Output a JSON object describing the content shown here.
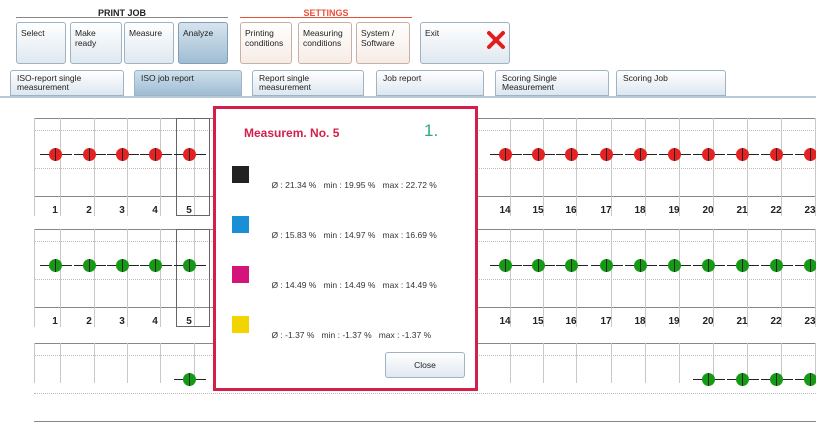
{
  "toolbar": {
    "groups": [
      {
        "title": "PRINT JOB",
        "color": "#222222",
        "line_color": "#888888"
      },
      {
        "title": "SETTINGS",
        "color": "#e8503a",
        "line_color": "#e8503a"
      }
    ],
    "buttons": [
      {
        "label": "Select",
        "active": false
      },
      {
        "label": "Make ready",
        "active": false
      },
      {
        "label": "Measure",
        "active": false
      },
      {
        "label": "Analyze",
        "active": true
      },
      {
        "label": "Printing conditions",
        "active": false
      },
      {
        "label": "Measuring conditions",
        "active": false
      },
      {
        "label": "System / Software",
        "active": false
      },
      {
        "label": "Exit",
        "active": false
      }
    ]
  },
  "tabs": [
    {
      "label": "ISO-report single measurement",
      "active": false
    },
    {
      "label": "ISO job report",
      "active": true
    },
    {
      "label": "Report single measurement",
      "active": false
    },
    {
      "label": "Job report",
      "active": false
    },
    {
      "label": "Scoring Single Measurement",
      "active": false
    },
    {
      "label": "Scoring Job",
      "active": false
    }
  ],
  "rows": {
    "numbers_left": [
      "1",
      "2",
      "3",
      "4",
      "5"
    ],
    "numbers_right": [
      "14",
      "15",
      "16",
      "17",
      "18",
      "19",
      "20",
      "21",
      "22",
      "23"
    ],
    "row1_color": "#e52222",
    "row2_color": "#169a16"
  },
  "dialog": {
    "title": "Measurem. No. 5",
    "step": "1.",
    "entries": [
      {
        "color": "#222222",
        "avg": "Ø : 21.34 %",
        "min": "min : 19.95 %",
        "max": "max : 22.72 %"
      },
      {
        "color": "#1a8fd6",
        "avg": "Ø : 15.83 %",
        "min": "min : 14.97 %",
        "max": "max : 16.69 %"
      },
      {
        "color": "#d4147a",
        "avg": "Ø : 14.49 %",
        "min": "min : 14.49 %",
        "max": "max : 14.49 %"
      },
      {
        "color": "#f2d500",
        "avg": "Ø : -1.37 %",
        "min": "min : -1.37 %",
        "max": "max : -1.37 %"
      }
    ],
    "close_label": "Close"
  }
}
